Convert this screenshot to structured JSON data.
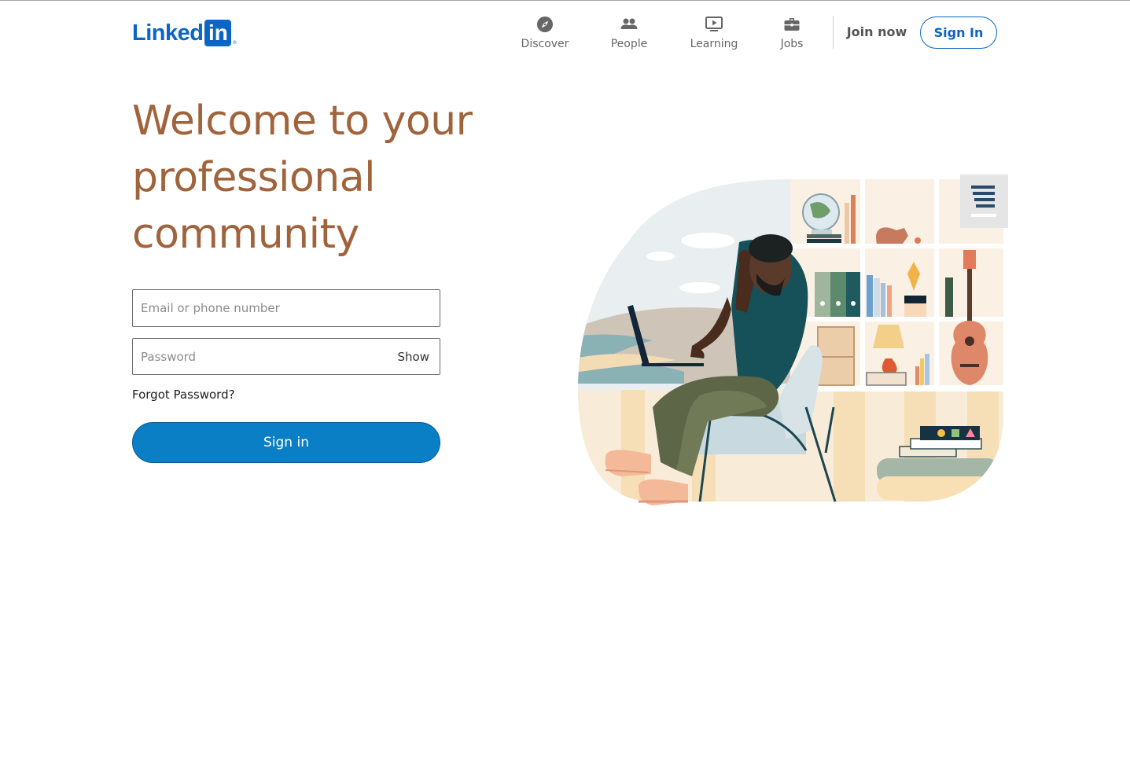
{
  "brand": {
    "name": "Linked",
    "box": "in",
    "reg": "®",
    "accent": "#0a66c2",
    "title_color": "#a0633c"
  },
  "nav": {
    "items": [
      {
        "label": "Discover",
        "icon": "compass-icon"
      },
      {
        "label": "People",
        "icon": "people-icon"
      },
      {
        "label": "Learning",
        "icon": "play-screen-icon"
      },
      {
        "label": "Jobs",
        "icon": "briefcase-icon"
      }
    ],
    "join_now": "Join now",
    "sign_in": "Sign In"
  },
  "hero": {
    "title": "Welcome to your professional community"
  },
  "form": {
    "email_placeholder": "Email or phone number",
    "password_placeholder": "Password",
    "show_label": "Show",
    "forgot_label": "Forgot Password?",
    "submit_label": "Sign in"
  }
}
